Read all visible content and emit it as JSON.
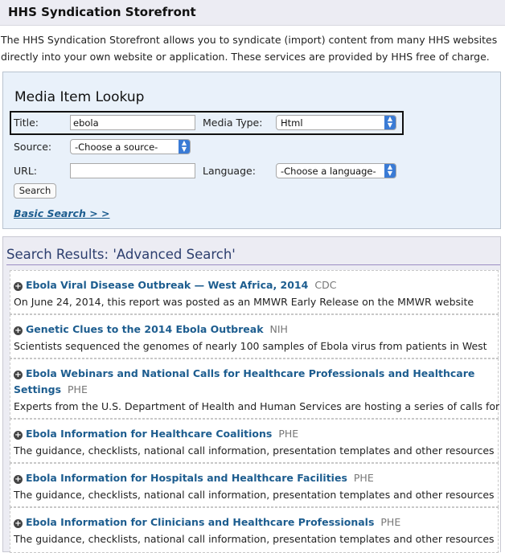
{
  "header": {
    "title": "HHS Syndication Storefront"
  },
  "intro": "The HHS Syndication Storefront allows you to syndicate (import) content from many HHS websites directly into your own website or application. These services are provided by HHS free of charge.",
  "lookup": {
    "title": "Media Item Lookup",
    "title_label": "Title:",
    "title_value": "ebola",
    "media_type_label": "Media Type:",
    "media_type_value": "Html",
    "source_label": "Source:",
    "source_value": "-Choose a source-",
    "url_label": "URL:",
    "url_value": "",
    "language_label": "Language:",
    "language_value": "-Choose a language-",
    "search_button": "Search",
    "basic_search_link": "Basic Search > >"
  },
  "results": {
    "heading": "Search Results: 'Advanced Search'",
    "items": [
      {
        "title": "Ebola Viral Disease Outbreak — West Africa, 2014",
        "source": "CDC",
        "desc": "On June 24, 2014, this report was posted as an MMWR Early Release on the MMWR website"
      },
      {
        "title": "Genetic Clues to the 2014 Ebola Outbreak",
        "source": "NIH",
        "desc": "Scientists sequenced the genomes of nearly 100 samples of Ebola virus from patients in West"
      },
      {
        "title": "Ebola Webinars and National Calls for Healthcare Professionals and Healthcare",
        "title_line2": "Settings",
        "source": "PHE",
        "desc": "Experts from the U.S. Department of Health and Human Services are hosting a series of calls for"
      },
      {
        "title": "Ebola Information for Healthcare Coalitions",
        "source": "PHE",
        "desc": "The guidance, checklists, national call information, presentation templates and other resources"
      },
      {
        "title": "Ebola Information for Hospitals and Healthcare Facilities",
        "source": "PHE",
        "desc": "The guidance, checklists, national call information, presentation templates and other resources"
      },
      {
        "title": "Ebola Information for Clinicians and Healthcare Professionals",
        "source": "PHE",
        "desc": "The guidance, checklists, national call information, presentation templates and other resources"
      }
    ]
  }
}
